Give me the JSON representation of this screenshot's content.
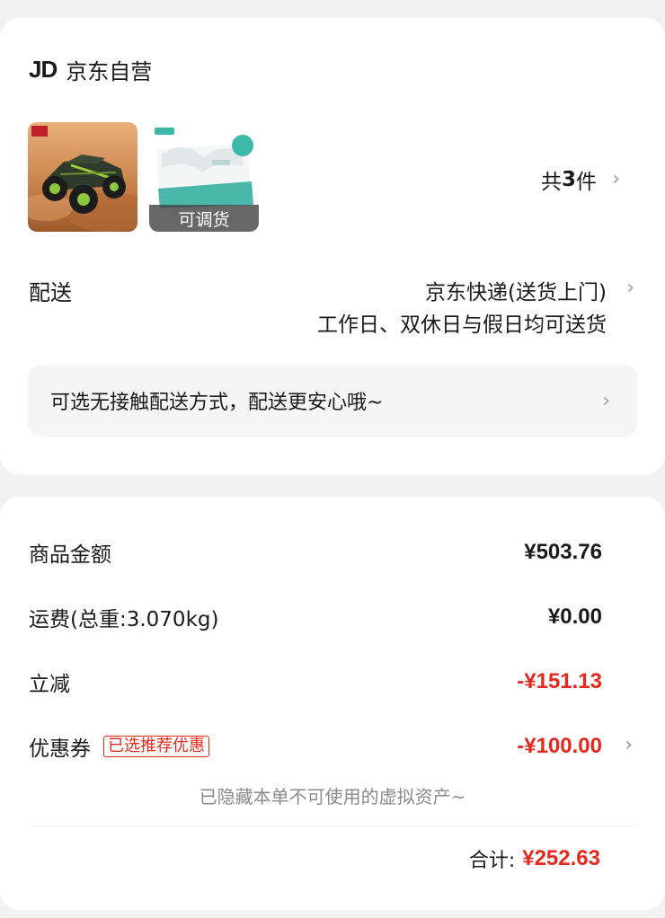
{
  "shop": {
    "logo": "JD",
    "name": "京东自营"
  },
  "items": {
    "transfer_tag": "可调货",
    "count_prefix": "共",
    "count": "3",
    "count_suffix": "件"
  },
  "delivery": {
    "label": "配送",
    "method": "京东快递(送货上门)",
    "time": "工作日、双休日与假日均可送货"
  },
  "contactless": {
    "text": "可选无接触配送方式，配送更安心哦~"
  },
  "summary": {
    "goods_label": "商品金额",
    "goods_value": "¥503.76",
    "freight_label": "运费(总重:3.070kg)",
    "freight_value": "¥0.00",
    "discount_label": "立减",
    "discount_value": "-¥151.13",
    "coupon_label": "优惠券",
    "coupon_badge": "已选推荐优惠",
    "coupon_value": "-¥100.00",
    "hidden_note": "已隐藏本单不可使用的虚拟资产~",
    "total_label": "合计:",
    "total_value": "¥252.63"
  },
  "colors": {
    "price_red": "#e4281e",
    "background": "#f2f2f2"
  },
  "icons": [
    "jd-logo-icon",
    "chevron-right-icon"
  ]
}
